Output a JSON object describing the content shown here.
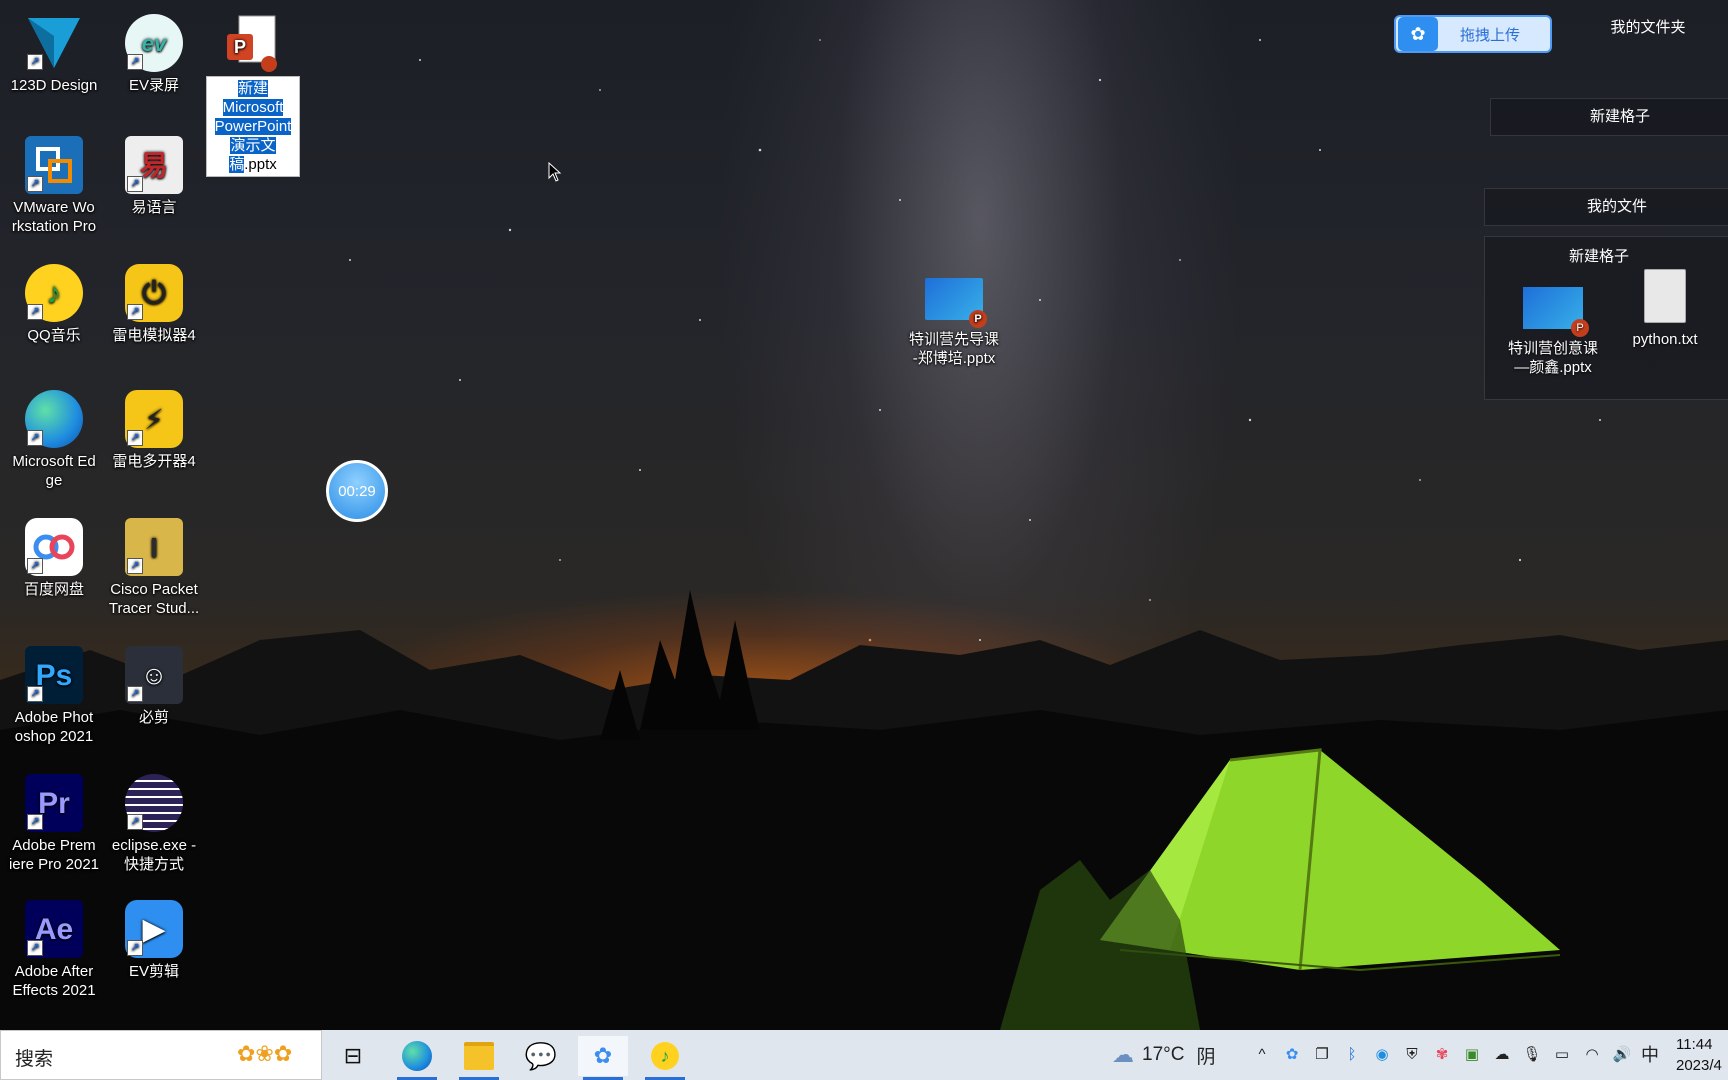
{
  "desktop_icons": [
    {
      "label": "123D Design",
      "icon": "123d-design-icon",
      "color": "#1a9ed8"
    },
    {
      "label": "EV录屏",
      "icon": "ev-recorder-icon",
      "color": "#35b5a8"
    },
    {
      "label": "VMware Workstation Pro",
      "label_line1": "VMware Wo",
      "label_line2": "rkstation Pro",
      "icon": "vmware-icon",
      "color": "#1b6fb8"
    },
    {
      "label": "易语言",
      "icon": "yiyuyan-icon",
      "color": "#c3262a"
    },
    {
      "label": "QQ音乐",
      "icon": "qq-music-icon",
      "color": "#ffd21f"
    },
    {
      "label": "雷电模拟器4",
      "icon": "leidian-emulator-icon",
      "color": "#f5c518"
    },
    {
      "label": "Microsoft Edge",
      "label_line1": "Microsoft Ed",
      "label_line2": "ge",
      "icon": "edge-icon",
      "color": "#1f8de0"
    },
    {
      "label": "雷电多开器4",
      "icon": "leidian-multi-icon",
      "color": "#f5c518"
    },
    {
      "label": "百度网盘",
      "icon": "baidu-netdisk-icon",
      "color": "#3b8ef0"
    },
    {
      "label": "Cisco Packet Tracer Stud...",
      "label_line1": "Cisco Packet",
      "label_line2": "Tracer Stud...",
      "icon": "cisco-packet-tracer-icon",
      "color": "#d9b64a"
    },
    {
      "label": "Adobe Photoshop 2021",
      "label_line1": "Adobe Phot",
      "label_line2": "oshop 2021",
      "icon": "photoshop-icon",
      "color": "#001e36",
      "glyph": "Ps",
      "glyph_color": "#31a8ff"
    },
    {
      "label": "必剪",
      "icon": "bijian-icon",
      "color": "#2b2f3a"
    },
    {
      "label": "Adobe Premiere Pro 2021",
      "label_line1": "Adobe Prem",
      "label_line2": "iere Pro 2021",
      "icon": "premiere-icon",
      "color": "#00005b",
      "glyph": "Pr",
      "glyph_color": "#9999ff"
    },
    {
      "label": "eclipse.exe - 快捷方式",
      "label_line1": "eclipse.exe -",
      "label_line2": "快捷方式",
      "icon": "eclipse-icon",
      "color": "#2c2255"
    },
    {
      "label": "Adobe After Effects 2021",
      "label_line1": "Adobe After",
      "label_line2": "Effects 2021",
      "icon": "after-effects-icon",
      "color": "#00005b",
      "glyph": "Ae",
      "glyph_color": "#9999ff"
    },
    {
      "label": "EV剪辑",
      "icon": "ev-editor-icon",
      "color": "#2f8ff0"
    }
  ],
  "selected_file": {
    "lines": [
      "新建",
      "Microsoft",
      "PowerPoint",
      "演示文",
      "稿"
    ],
    "tail": ".pptx",
    "icon": "powerpoint-file-icon"
  },
  "center_file": {
    "line1": "特训营先导课",
    "line2": "-郑博培.pptx",
    "icon": "pptx-thumbnail-icon"
  },
  "timer": {
    "text": "00:29"
  },
  "fences": {
    "upload_button": "拖拽上传",
    "my_folder": "我的文件夹",
    "new_fence_1": "新建格子",
    "my_files": "我的文件",
    "new_fence_2": "新建格子",
    "file_a": {
      "line1": "特训营创意课",
      "line2": "—颜鑫.pptx"
    },
    "file_b": "python.txt"
  },
  "taskbar": {
    "search_placeholder": "搜索",
    "apps": [
      "task-view-icon",
      "edge-icon",
      "file-explorer-icon",
      "wechat-icon",
      "baidu-netdisk-icon",
      "qq-music-icon"
    ],
    "weather_temp": "17°C",
    "weather_desc": "阴",
    "ime": "中",
    "time": "11:44",
    "date": "2023/4"
  },
  "colors": {
    "taskbar_bg": "#dfe6ee",
    "selection": "#0a64c8",
    "tent": "#8fd62a",
    "accent_blue": "#2a6fd6"
  }
}
